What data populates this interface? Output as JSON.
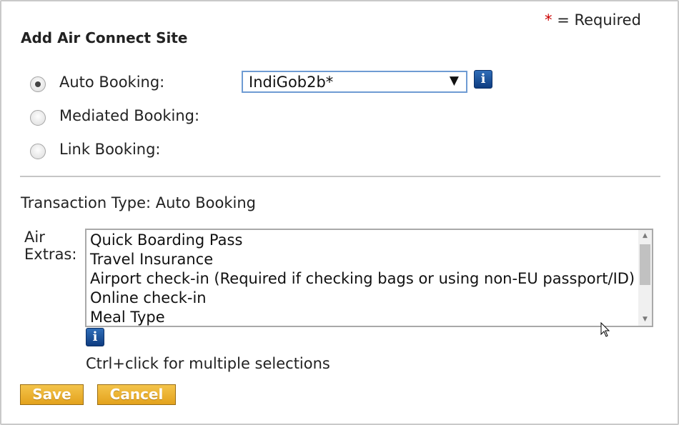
{
  "dialog": {
    "title": "Add Air Connect Site",
    "required_note": {
      "star": "*",
      "text": "= Required"
    }
  },
  "booking_types": [
    {
      "label": "Auto Booking:",
      "selected": true
    },
    {
      "label": "Mediated Booking:",
      "selected": false
    },
    {
      "label": "Link Booking:",
      "selected": false
    }
  ],
  "site_select": {
    "value": "IndiGob2b*",
    "arrow": "▼"
  },
  "info_icon": {
    "glyph": "i",
    "name": "info-icon"
  },
  "transaction_type": "Transaction Type: Auto Booking",
  "air_extras": {
    "label_line1": "Air",
    "label_line2": "Extras:",
    "options": [
      "Quick Boarding Pass",
      "Travel Insurance",
      "Airport check-in (Required if checking bags or using non-EU passport/ID)",
      "Online check-in",
      "Meal Type"
    ],
    "hint": "Ctrl+click for multiple selections"
  },
  "buttons": {
    "save": "Save",
    "cancel": "Cancel"
  },
  "colors": {
    "button_gold": "#e8a823",
    "info_blue": "#1a4f9c",
    "required_red": "#cc0000",
    "select_border": "#6e9bd3"
  }
}
